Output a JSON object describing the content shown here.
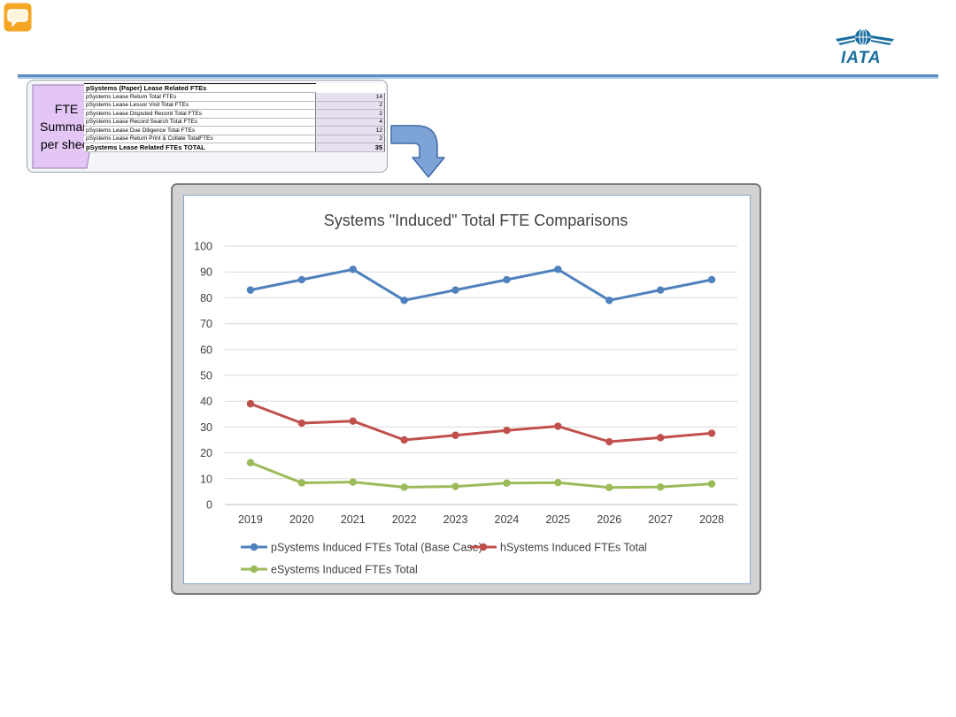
{
  "colors": {
    "accent_line": "#5b8cc2",
    "fte_box": "#e3c6f5",
    "series_p": "#4f81bd",
    "series_h": "#c0504d",
    "series_e": "#9bbb59",
    "comment_icon": "#f5a623",
    "logo": "#1a6fa1"
  },
  "icons": {
    "comment": "speech-bubble-icon",
    "logo": "iata-globe-logo"
  },
  "header": {
    "logo_text": "IATA"
  },
  "fte_summary": {
    "label_lines": [
      "FTE",
      "Summary",
      "per sheet"
    ],
    "title": "pSystems (Paper) Lease Related FTEs",
    "rows": [
      {
        "label": "pSystems Lease Return Total FTEs",
        "value": "14"
      },
      {
        "label": "pSystems Lease Lessor Visit Total FTEs",
        "value": "2"
      },
      {
        "label": "pSystems Lease Disputed Record Total FTEs",
        "value": "2"
      },
      {
        "label": "pSystems Lease Record Search Total FTEs",
        "value": "4"
      },
      {
        "label": "pSystems Lease Due Diligence Total FTEs",
        "value": "12"
      },
      {
        "label": "pSystems Lease Return Print & Collate TotalFTEs",
        "value": "2"
      }
    ],
    "total": {
      "label": "pSystems Lease Related FTEs TOTAL",
      "value": "35"
    }
  },
  "chart_data": {
    "type": "line",
    "title": "Systems \"Induced\" Total FTE Comparisons",
    "xlabel": "",
    "ylabel": "",
    "categories": [
      "2019",
      "2020",
      "2021",
      "2022",
      "2023",
      "2024",
      "2025",
      "2026",
      "2027",
      "2028"
    ],
    "ylim": [
      0,
      100
    ],
    "yticks": [
      0,
      10,
      20,
      30,
      40,
      50,
      60,
      70,
      80,
      90,
      100
    ],
    "grid": true,
    "legend_position": "bottom",
    "series": [
      {
        "name": "pSystems Induced FTEs Total (Base Case)",
        "color": "#4f81bd",
        "values": [
          83,
          87,
          91,
          79,
          83,
          87,
          91,
          79,
          83,
          87
        ]
      },
      {
        "name": "hSystems Induced FTEs Total",
        "color": "#c0504d",
        "values": [
          39,
          31.5,
          32.3,
          25,
          26.8,
          28.7,
          30.3,
          24.3,
          25.9,
          27.6
        ]
      },
      {
        "name": "eSystems Induced FTEs Total",
        "color": "#9bbb59",
        "values": [
          16.2,
          8.4,
          8.7,
          6.7,
          7,
          8.3,
          8.5,
          6.6,
          6.8,
          8
        ]
      }
    ]
  }
}
